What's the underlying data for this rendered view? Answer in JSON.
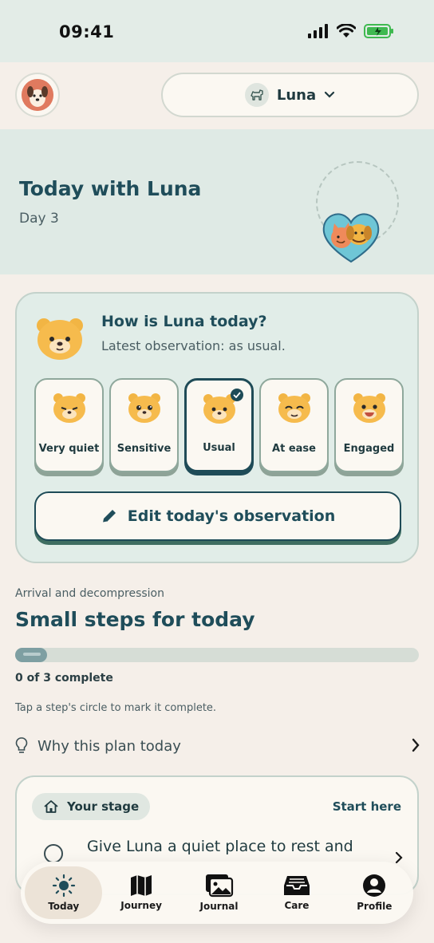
{
  "status_bar": {
    "time": "09:41"
  },
  "header": {
    "pet_name": "Luna"
  },
  "hero": {
    "title": "Today with Luna",
    "subtitle": "Day 3"
  },
  "mood": {
    "question": "How is Luna today?",
    "latest": "Latest observation: as usual.",
    "options": [
      {
        "label": "Very quiet"
      },
      {
        "label": "Sensitive"
      },
      {
        "label": "Usual"
      },
      {
        "label": "At ease"
      },
      {
        "label": "Engaged"
      }
    ],
    "selected": "Usual",
    "edit_label": "Edit today's observation"
  },
  "steps": {
    "kicker": "Arrival and decompression",
    "title": "Small steps for today",
    "progress_completed": 0,
    "progress_total": 3,
    "progress_text": "0 of 3 complete",
    "hint": "Tap a step's circle to mark it complete.",
    "why_label": "Why this plan today"
  },
  "stage_card": {
    "pill": "Your stage",
    "start": "Start here",
    "task": "Give Luna a quiet place to rest and"
  },
  "tabs": [
    {
      "label": "Today",
      "icon": "sun-icon"
    },
    {
      "label": "Journey",
      "icon": "map-icon"
    },
    {
      "label": "Journal",
      "icon": "photo-icon"
    },
    {
      "label": "Care",
      "icon": "inbox-icon"
    },
    {
      "label": "Profile",
      "icon": "profile-icon"
    }
  ],
  "colors": {
    "primary": "#1f4d5a",
    "card": "#e1ede8",
    "background": "#f5efe9"
  }
}
